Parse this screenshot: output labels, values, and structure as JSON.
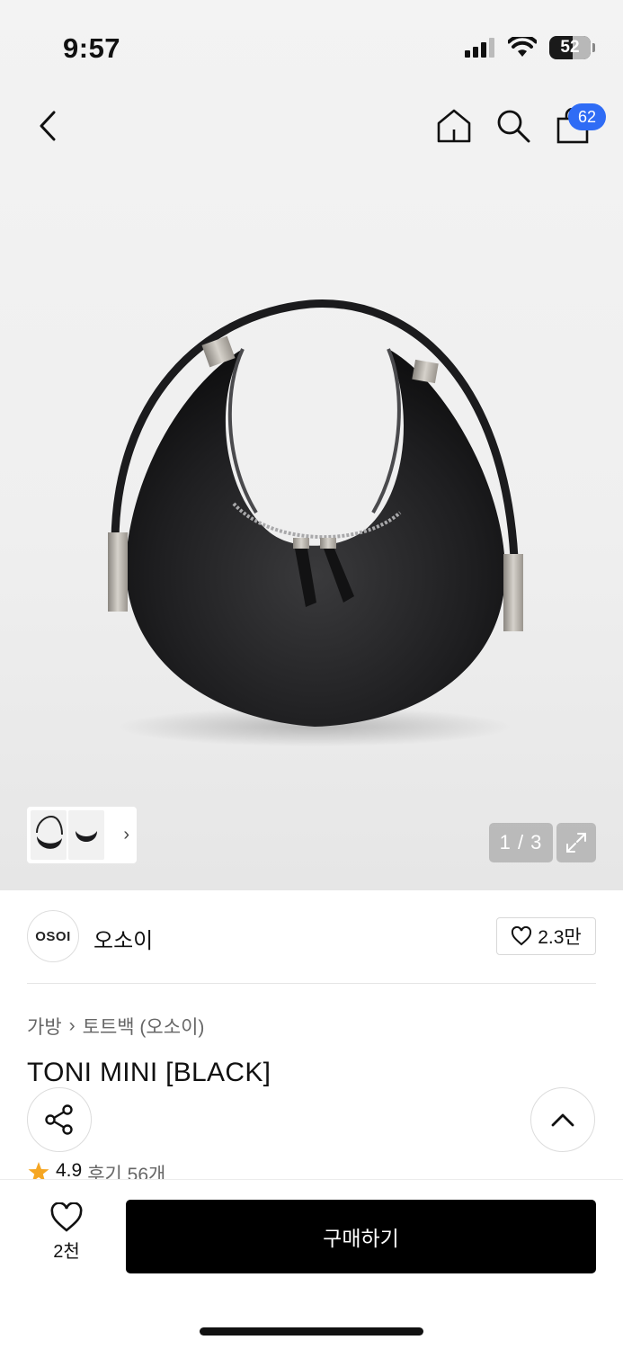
{
  "status_bar": {
    "time": "9:57",
    "battery": "52"
  },
  "nav": {
    "cart_count": "62"
  },
  "gallery": {
    "counter": "1 / 3"
  },
  "brand": {
    "logo_text": "OSOI",
    "name": "오소이",
    "likes": "2.3만"
  },
  "breadcrumb": {
    "category": "가방",
    "subcategory": "토트백 (오소이)"
  },
  "product": {
    "title": "TONI MINI [BLACK]",
    "rating": "4.9",
    "reviews": "후기 56개"
  },
  "bottom_bar": {
    "wish_count": "2천",
    "buy_label": "구매하기"
  },
  "colors": {
    "badge": "#2f6cf5",
    "buy_button": "#000000",
    "star": "#f5a623"
  }
}
